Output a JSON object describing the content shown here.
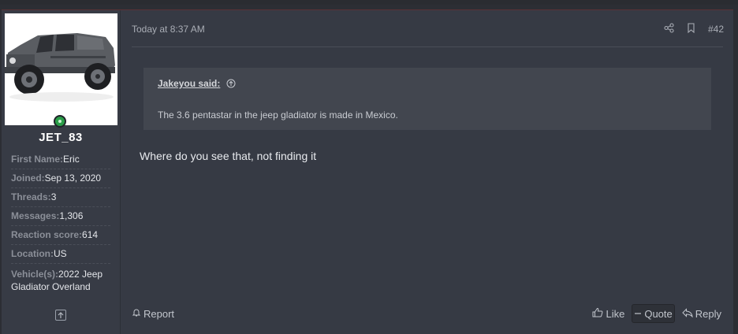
{
  "user": {
    "username": "JET_83",
    "fields": [
      {
        "label": "First Name:",
        "value": "Eric"
      },
      {
        "label": "Joined:",
        "value": "Sep 13, 2020"
      },
      {
        "label": "Threads:",
        "value": "3"
      },
      {
        "label": "Messages:",
        "value": "1,306"
      },
      {
        "label": "Reaction score:",
        "value": "614"
      },
      {
        "label": "Location:",
        "value": "US"
      },
      {
        "label": "Vehicle(s):",
        "value": "2022 Jeep Gladiator Overland"
      }
    ],
    "online": true
  },
  "post": {
    "timestamp": "Today at 8:37 AM",
    "number": "#42",
    "quote": {
      "author": "Jakeyou said:",
      "text": "The 3.6 pentastar in the jeep gladiator is made in Mexico."
    },
    "message": "Where do you see that, not finding it"
  },
  "footer": {
    "report": "Report",
    "like": "Like",
    "quote": "Quote",
    "reply": "Reply"
  },
  "icons": {
    "share": "share-icon",
    "bookmark": "bookmark-icon",
    "up": "up-arrow-icon"
  },
  "colors": {
    "background": "#2c2e34",
    "post": "#363a44",
    "quote": "#42464f",
    "online": "#2a9d48"
  }
}
